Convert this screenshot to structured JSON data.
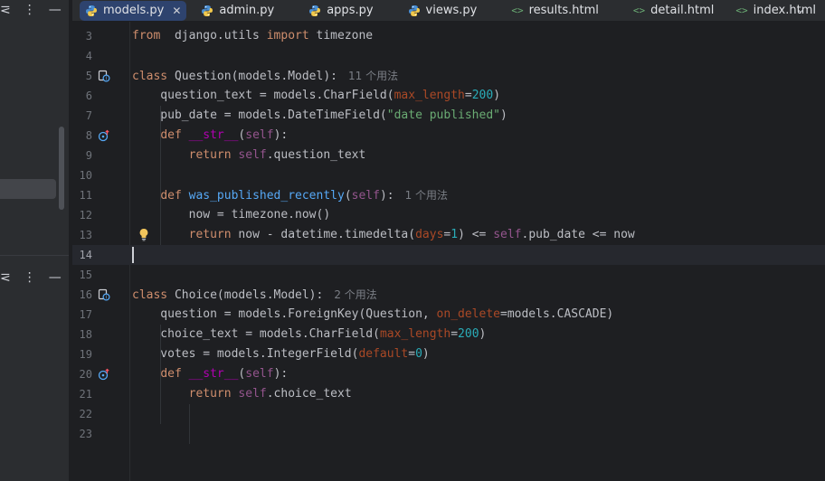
{
  "left_panel": {
    "top_icons": [
      "collapse-icon",
      "more-icon",
      "minimize-icon"
    ],
    "mid_icons": [
      "collapse-icon",
      "more-icon",
      "minimize-icon"
    ]
  },
  "tabs": [
    {
      "label": "models.py",
      "icon": "python-file-icon",
      "active": true,
      "closable": true
    },
    {
      "label": "admin.py",
      "icon": "python-file-icon"
    },
    {
      "label": "apps.py",
      "icon": "python-file-icon"
    },
    {
      "label": "views.py",
      "icon": "python-file-icon"
    },
    {
      "label": "results.html",
      "icon": "html-file-icon"
    },
    {
      "label": "detail.html",
      "icon": "html-file-icon"
    },
    {
      "label": "index.html",
      "icon": "html-file-icon"
    }
  ],
  "glyphs": {
    "close": "✕",
    "overflow": "⌄",
    "xml": "<>",
    "collapse": "⋜",
    "more": "⋮",
    "minimize": "—"
  },
  "editor": {
    "current_line": 14,
    "lines": [
      {
        "n": "3",
        "segs": [
          [
            "kw",
            "from"
          ],
          [
            "",
            "  django.utils "
          ],
          [
            "kw",
            "import"
          ],
          [
            "",
            " timezone"
          ]
        ]
      },
      {
        "n": "4",
        "segs": []
      },
      {
        "n": "5",
        "icon": "class-usages-icon",
        "segs": [
          [
            "kw",
            "class"
          ],
          [
            "",
            " Question(models.Model):"
          ]
        ],
        "hint": "11 个用法"
      },
      {
        "n": "6",
        "segs": [
          [
            "",
            "    question_text = models.CharField("
          ],
          [
            "param",
            "max_length"
          ],
          [
            "",
            "="
          ],
          [
            "num",
            "200"
          ],
          [
            "",
            ")"
          ]
        ]
      },
      {
        "n": "7",
        "segs": [
          [
            "",
            "    pub_date = models.DateTimeField("
          ],
          [
            "str",
            "\"date published\""
          ],
          [
            "",
            ")"
          ]
        ]
      },
      {
        "n": "8",
        "icon": "override-icon",
        "segs": [
          [
            "",
            "    "
          ],
          [
            "kw",
            "def"
          ],
          [
            "",
            " "
          ],
          [
            "dunder",
            "__str__"
          ],
          [
            "",
            "("
          ],
          [
            "self",
            "self"
          ],
          [
            "",
            "):"
          ]
        ]
      },
      {
        "n": "9",
        "segs": [
          [
            "",
            "        "
          ],
          [
            "kw",
            "return"
          ],
          [
            "",
            " "
          ],
          [
            "self",
            "self"
          ],
          [
            "",
            ".question_text"
          ]
        ]
      },
      {
        "n": "10",
        "segs": []
      },
      {
        "n": "11",
        "segs": [
          [
            "",
            "    "
          ],
          [
            "kw",
            "def"
          ],
          [
            "",
            " "
          ],
          [
            "fn",
            "was_published_recently"
          ],
          [
            "",
            "("
          ],
          [
            "self",
            "self"
          ],
          [
            "",
            "):"
          ]
        ],
        "hint": "1 个用法"
      },
      {
        "n": "12",
        "segs": [
          [
            "",
            "        now = timezone.now()"
          ]
        ]
      },
      {
        "n": "13",
        "bulb": true,
        "segs": [
          [
            "",
            "        "
          ],
          [
            "kw",
            "return"
          ],
          [
            "",
            " now - datetime.timedelta("
          ],
          [
            "param",
            "days"
          ],
          [
            "",
            "="
          ],
          [
            "num",
            "1"
          ],
          [
            "",
            ") <= "
          ],
          [
            "self",
            "self"
          ],
          [
            "",
            ".pub_date <= now"
          ]
        ]
      },
      {
        "n": "14",
        "segs": []
      },
      {
        "n": "15",
        "segs": []
      },
      {
        "n": "16",
        "icon": "class-usages-icon",
        "segs": [
          [
            "kw",
            "class"
          ],
          [
            "",
            " Choice(models.Model):"
          ]
        ],
        "hint": "2 个用法"
      },
      {
        "n": "17",
        "segs": [
          [
            "",
            "    question = models.ForeignKey(Question, "
          ],
          [
            "param",
            "on_delete"
          ],
          [
            "",
            "=models.CASCADE)"
          ]
        ]
      },
      {
        "n": "18",
        "segs": [
          [
            "",
            "    choice_text = models.CharField("
          ],
          [
            "param",
            "max_length"
          ],
          [
            "",
            "="
          ],
          [
            "num",
            "200"
          ],
          [
            "",
            ")"
          ]
        ]
      },
      {
        "n": "19",
        "segs": [
          [
            "",
            "    votes = models.IntegerField("
          ],
          [
            "param",
            "default"
          ],
          [
            "",
            "="
          ],
          [
            "num",
            "0"
          ],
          [
            "",
            ")"
          ]
        ]
      },
      {
        "n": "20",
        "icon": "override-icon",
        "segs": [
          [
            "",
            "    "
          ],
          [
            "kw",
            "def"
          ],
          [
            "",
            " "
          ],
          [
            "dunder",
            "__str__"
          ],
          [
            "",
            "("
          ],
          [
            "self",
            "self"
          ],
          [
            "",
            "):"
          ]
        ]
      },
      {
        "n": "21",
        "segs": [
          [
            "",
            "        "
          ],
          [
            "kw",
            "return"
          ],
          [
            "",
            " "
          ],
          [
            "self",
            "self"
          ],
          [
            "",
            ".choice_text"
          ]
        ]
      },
      {
        "n": "22",
        "segs": []
      },
      {
        "n": "23",
        "segs": []
      }
    ]
  }
}
